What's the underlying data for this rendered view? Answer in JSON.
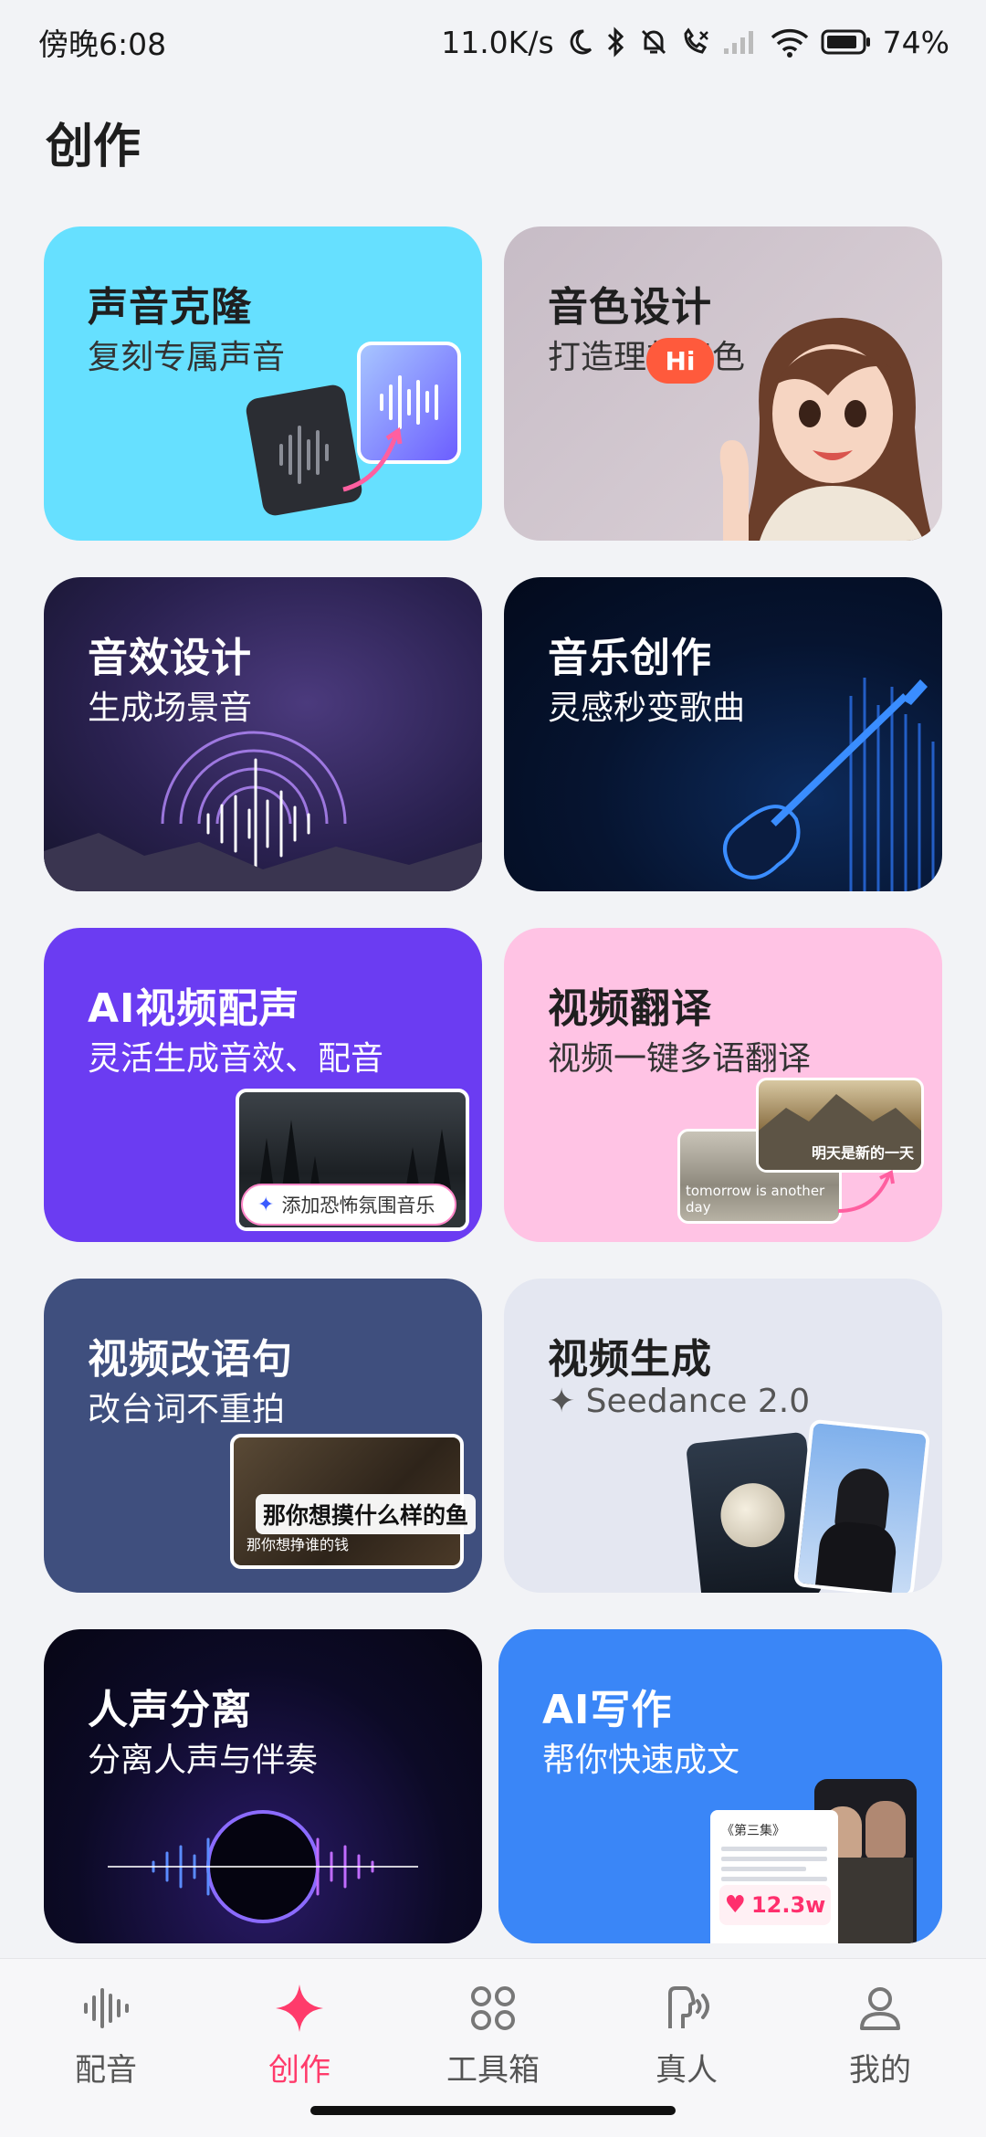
{
  "status_bar": {
    "time": "傍晚6:08",
    "network_speed": "11.0K/s",
    "battery": "74%"
  },
  "page": {
    "title": "创作"
  },
  "cards": [
    {
      "title": "声音克隆",
      "subtitle": "复刻专属声音"
    },
    {
      "title": "音色设计",
      "subtitle": "打造理想音色",
      "bubble": "Hi"
    },
    {
      "title": "音效设计",
      "subtitle": "生成场景音"
    },
    {
      "title": "音乐创作",
      "subtitle": "灵感秒变歌曲"
    },
    {
      "title": "AI视频配声",
      "subtitle": "灵活生成音效、配音",
      "chip": "添加恐怖氛围音乐"
    },
    {
      "title": "视频翻译",
      "subtitle": "视频一键多语翻译",
      "caption_en": "tomorrow is another day",
      "caption_zh": "明天是新的一天"
    },
    {
      "title": "视频改语句",
      "subtitle": "改台词不重拍",
      "caption_main": "那你想摸什么样的鱼",
      "caption_small": "那你想挣谁的钱"
    },
    {
      "title": "视频生成",
      "subtitle": "✦ Seedance 2.0"
    },
    {
      "title": "人声分离",
      "subtitle": "分离人声与伴奏"
    },
    {
      "title": "AI写作",
      "subtitle": "帮你快速成文",
      "doc_title": "《第三集》",
      "likes": "12.3w"
    }
  ],
  "bottom_nav": [
    {
      "label": "配音",
      "icon": "waveform-icon"
    },
    {
      "label": "创作",
      "icon": "sparkle-icon",
      "active": true
    },
    {
      "label": "工具箱",
      "icon": "grid-icon"
    },
    {
      "label": "真人",
      "icon": "person-voice-icon"
    },
    {
      "label": "我的",
      "icon": "profile-icon"
    }
  ],
  "colors": {
    "accent": "#ff3b6b",
    "voice_clone_bg": "#66e0ff",
    "video_dub_bg": "#6b3cf2",
    "video_translate_bg": "#ffc3e4",
    "ai_writing_bg": "#3a86f7"
  }
}
